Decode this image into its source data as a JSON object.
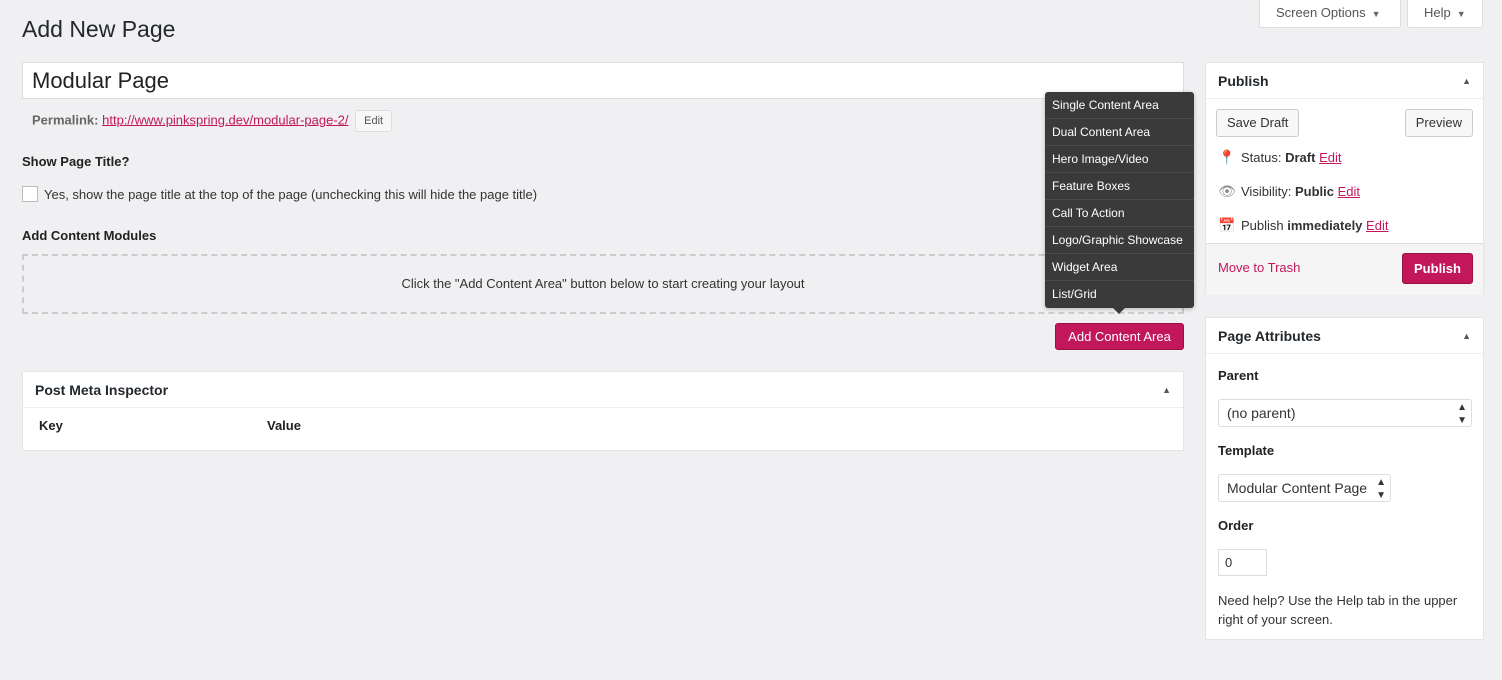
{
  "screen_tabs": {
    "screen_options": "Screen Options",
    "help": "Help"
  },
  "page_title": "Add New Page",
  "title_input": {
    "value": "Modular Page"
  },
  "permalink": {
    "label": "Permalink:",
    "url": "http://www.pinkspring.dev/modular-page-2/",
    "edit": "Edit"
  },
  "show_title": {
    "heading": "Show Page Title?",
    "checkbox_label": "Yes, show the page title at the top of the page (unchecking this will hide the page title)",
    "checked": false
  },
  "modules": {
    "heading": "Add Content Modules",
    "placeholder": "Click the \"Add Content Area\" button below to start creating your layout",
    "add_button": "Add Content Area",
    "menu": [
      "Single Content Area",
      "Dual Content Area",
      "Hero Image/Video",
      "Feature Boxes",
      "Call To Action",
      "Logo/Graphic Showcase",
      "Widget Area",
      "List/Grid"
    ]
  },
  "meta_inspector": {
    "title": "Post Meta Inspector",
    "col_key": "Key",
    "col_value": "Value"
  },
  "publish": {
    "title": "Publish",
    "save_draft": "Save Draft",
    "preview": "Preview",
    "status_label": "Status:",
    "status_value": "Draft",
    "visibility_label": "Visibility:",
    "visibility_value": "Public",
    "publish_label": "Publish",
    "publish_value": "immediately",
    "edit": "Edit",
    "trash": "Move to Trash",
    "publish_button": "Publish"
  },
  "attributes": {
    "title": "Page Attributes",
    "parent_label": "Parent",
    "parent_value": "(no parent)",
    "template_label": "Template",
    "template_value": "Modular Content Page",
    "order_label": "Order",
    "order_value": "0",
    "help": "Need help? Use the Help tab in the upper right of your screen."
  },
  "colors": {
    "accent": "#c2185b",
    "background": "#f0eff1",
    "menu_bg": "#3a3a3a"
  }
}
